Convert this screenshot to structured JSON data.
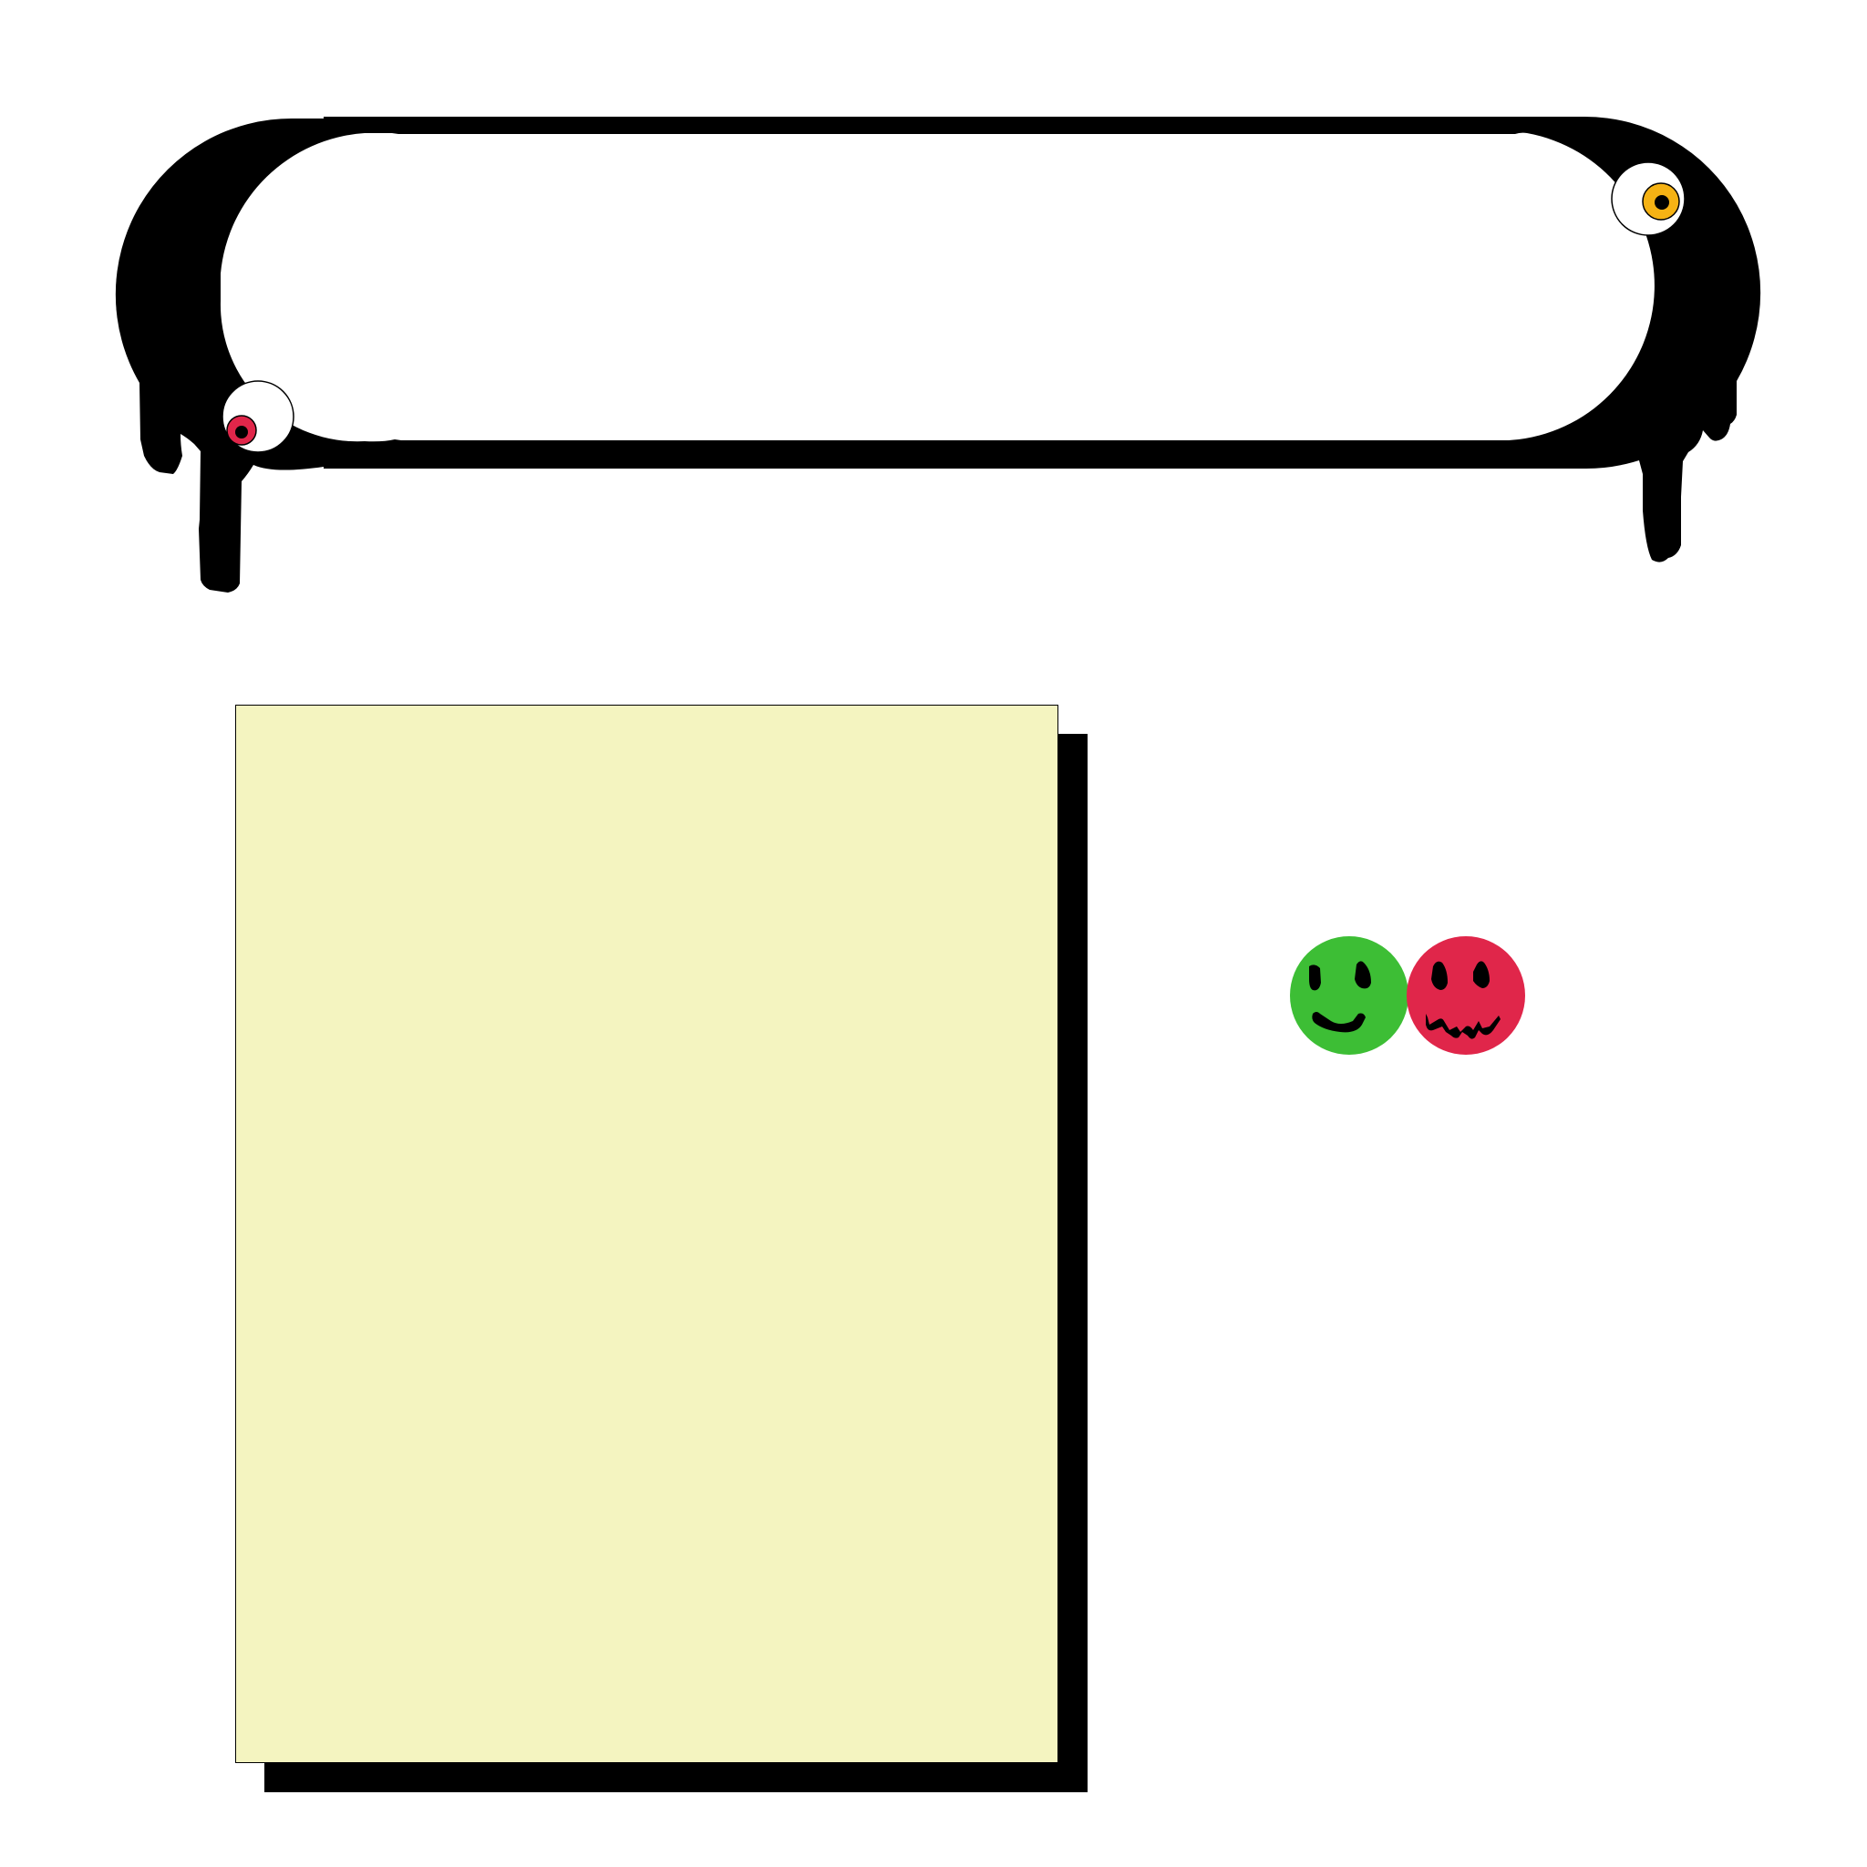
{
  "banner": {
    "frame_color": "#000000",
    "panel_color": "#ffffff",
    "eyes": [
      {
        "name": "left-eye",
        "iris_color": "#e0264a"
      },
      {
        "name": "right-eye",
        "iris_color": "#f5b214"
      }
    ],
    "text": ""
  },
  "note": {
    "color": "#f4f4c0",
    "shadow_color": "#000000",
    "text": ""
  },
  "faces": [
    {
      "name": "happy-face-icon",
      "color": "#3dbe35",
      "mood": "happy"
    },
    {
      "name": "sad-face-icon",
      "color": "#e0264a",
      "mood": "sad"
    }
  ]
}
